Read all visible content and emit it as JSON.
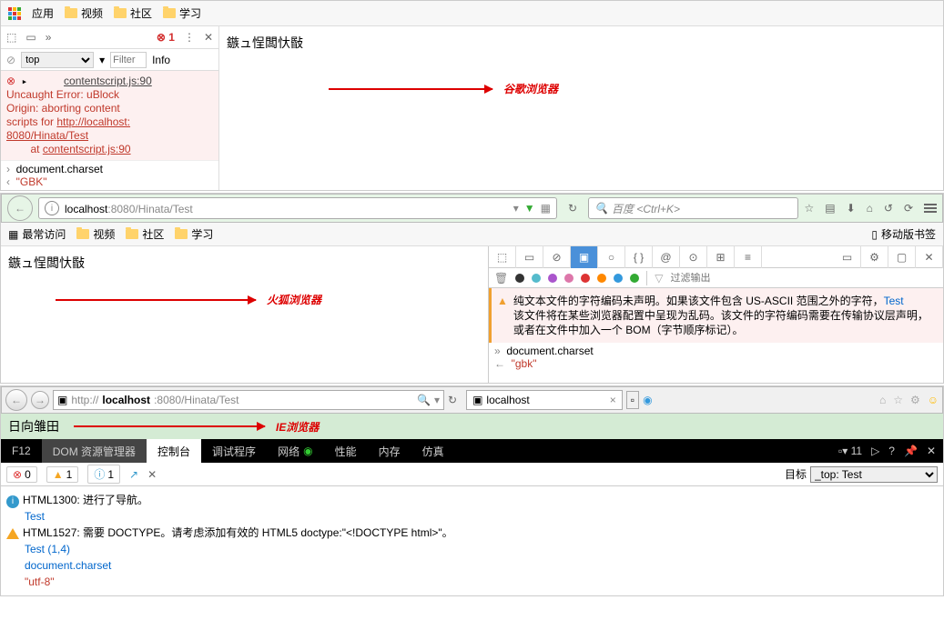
{
  "chrome": {
    "bookmarks": {
      "apps": "应用",
      "items": [
        "视频",
        "社区",
        "学习"
      ]
    },
    "devtools": {
      "error_count": "1",
      "context": "top",
      "filter_placeholder": "Filter",
      "info_label": "Info",
      "error": {
        "link1": "contentscript.js:90",
        "line1": "Uncaught Error: uBlock",
        "line2": "Origin: aborting content",
        "line3_prefix": "scripts for ",
        "line3_link": "http://localhost:",
        "line4": "8080/Hinata/Test",
        "line5_prefix": "at ",
        "line5_link": "contentscript.js:90"
      },
      "input": "document.charset",
      "output": "\"GBK\""
    },
    "page_text": "鏃ュ悜闆忕敯",
    "annotation": "谷歌浏览器"
  },
  "firefox": {
    "url": {
      "host": "localhost",
      "port": ":8080",
      "path": "/Hinata/Test"
    },
    "search_placeholder": "百度 <Ctrl+K>",
    "bookmarks": {
      "most": "最常访问",
      "items": [
        "视频",
        "社区",
        "学习"
      ]
    },
    "mobile_bookmarks": "移动版书签",
    "page_text": "鏃ュ悜闆忕敯",
    "annotation": "火狐浏览器",
    "devtools": {
      "filter_placeholder": "过滤输出",
      "warning": {
        "text1": "纯文本文件的字符编码未声明。如果该文件包含 US-ASCII 范围之外的字符，",
        "link": "Test",
        "text2": "该文件将在某些浏览器配置中呈现为乱码。该文件的字符编码需要在传输协议层声明，或者在文件中加入一个 BOM（字节顺序标记）。"
      },
      "input": "document.charset",
      "output": "\"gbk\""
    }
  },
  "ie": {
    "url_prefix": "http://",
    "url_host": "localhost",
    "url_rest": ":8080/Hinata/Test",
    "tab_title": "localhost",
    "page_text": "日向雏田",
    "annotation": "IE浏览器",
    "devtools": {
      "tabs": {
        "f12": "F12",
        "dom": "DOM 资源管理器",
        "console": "控制台",
        "debug": "调试程序",
        "network": "网络",
        "perf": "性能",
        "memory": "内存",
        "emul": "仿真",
        "count": "11"
      },
      "badges": {
        "err": "0",
        "warn": "1",
        "info": "1"
      },
      "target_label": "目标",
      "target_value": "_top: Test",
      "lines": {
        "l1a": "HTML1300: 进行了导航。",
        "l1b": "Test",
        "l2a": "HTML1527: 需要 DOCTYPE。请考虑添加有效的 HTML5 doctype:\"<!DOCTYPE html>\"。",
        "l2b": "Test (1,4)",
        "l3": "document.charset",
        "l4": "\"utf-8\""
      }
    }
  }
}
